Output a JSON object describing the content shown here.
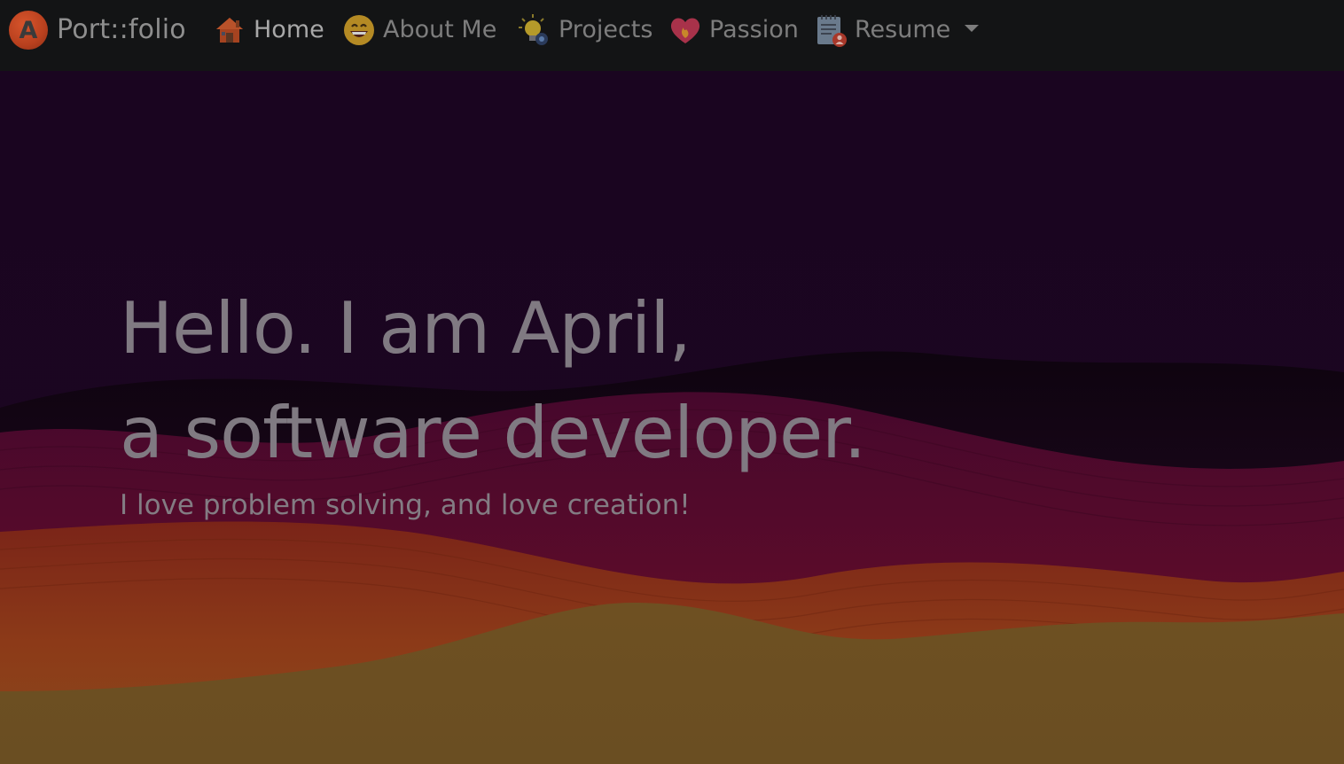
{
  "navbar": {
    "brand": {
      "logo_letter": "A",
      "logo_icon": "letter-a-logo-icon",
      "text": "Port::folio"
    },
    "items": [
      {
        "label": "Home",
        "icon": "house-icon",
        "active": true
      },
      {
        "label": "About Me",
        "icon": "grinning-face-icon",
        "active": false
      },
      {
        "label": "Projects",
        "icon": "lightbulb-icon",
        "active": false
      },
      {
        "label": "Passion",
        "icon": "heart-fire-icon",
        "active": false
      },
      {
        "label": "Resume",
        "icon": "notepad-user-icon",
        "active": false,
        "dropdown": true
      }
    ]
  },
  "hero": {
    "line1": "Hello. I am April,",
    "line2": "a software developer.",
    "tagline": "I love problem solving, and love creation!"
  },
  "colors": {
    "navbar_bg": "#131415",
    "hero_top": "#1a0621",
    "wave_dark": "#2a0a2c",
    "wave_crimson": "#5e0c2c",
    "wave_orange": "#8a3a1a",
    "wave_gold": "#6a4e22",
    "text_muted": "#807a82"
  }
}
